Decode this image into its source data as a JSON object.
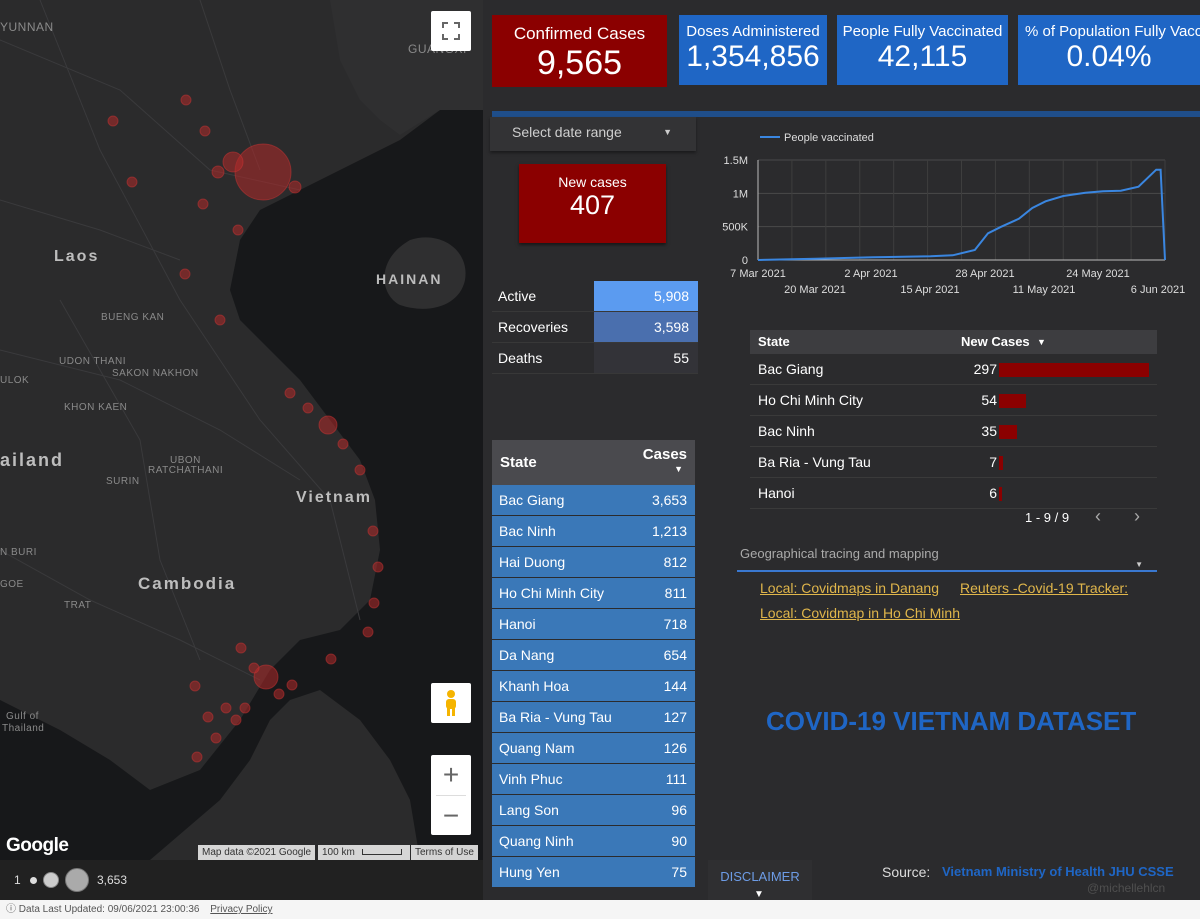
{
  "map": {
    "labels": {
      "laos": "Laos",
      "hainan": "HAINAN",
      "vietnam": "Vietnam",
      "cambodia": "Cambodia",
      "thailand": "ailand",
      "yunnan": "YUNNAN",
      "guangxi": "GUANGXI",
      "bueng_kan": "BUENG KAN",
      "udon_thani": "UDON THANI",
      "sakon_nakhon": "SAKON NAKHON",
      "lok": "ULOK",
      "khon_kaen": "KHON KAEN",
      "ubon": "UBON",
      "ratchathani": "RATCHATHANI",
      "surin": "SURIN",
      "buri": "N BURI",
      "goe": "GOE",
      "trat": "TRAT",
      "gulf1": "Gulf of",
      "gulf2": "Thailand"
    },
    "attribution": {
      "data": "Map data ©2021 Google",
      "scale": "100 km",
      "terms": "Terms of Use"
    },
    "google_logo": "Google",
    "legend": {
      "min": "1",
      "max": "3,653"
    }
  },
  "kpis": {
    "confirmed": {
      "label": "Confirmed Cases",
      "value": "9,565",
      "color": "#8b0000"
    },
    "doses": {
      "label": "Doses Administered",
      "value": "1,354,856",
      "color": "#1f66c5"
    },
    "fully": {
      "label": "People Fully Vaccinated",
      "value": "42,115",
      "color": "#1f66c5"
    },
    "percent": {
      "label": "% of Population Fully Vacc",
      "value": "0.04%",
      "color": "#1f66c5"
    },
    "new_cases": {
      "label": "New cases",
      "value": "407",
      "color": "#8b0000"
    }
  },
  "date_range": {
    "label": "Select date range"
  },
  "status": [
    {
      "name": "Active",
      "value": "5,908",
      "fraction": 1.0,
      "color": "#5b9bf0"
    },
    {
      "name": "Recoveries",
      "value": "3,598",
      "fraction": 1.0,
      "color": "#4a6fae"
    },
    {
      "name": "Deaths",
      "value": "55",
      "fraction": 1.0,
      "color": "#333338"
    }
  ],
  "state_table": {
    "headers": {
      "state": "State",
      "cases": "Cases"
    },
    "rows": [
      {
        "state": "Bac Giang",
        "cases": "3,653"
      },
      {
        "state": "Bac Ninh",
        "cases": "1,213"
      },
      {
        "state": "Hai Duong",
        "cases": "812"
      },
      {
        "state": "Ho Chi Minh City",
        "cases": "811"
      },
      {
        "state": "Hanoi",
        "cases": "718"
      },
      {
        "state": "Da Nang",
        "cases": "654"
      },
      {
        "state": "Khanh Hoa",
        "cases": "144"
      },
      {
        "state": "Ba Ria - Vung Tau",
        "cases": "127"
      },
      {
        "state": "Quang Nam",
        "cases": "126"
      },
      {
        "state": "Vinh Phuc",
        "cases": "111"
      },
      {
        "state": "Lang Son",
        "cases": "96"
      },
      {
        "state": "Quang Ninh",
        "cases": "90"
      },
      {
        "state": "Hung Yen",
        "cases": "75"
      }
    ]
  },
  "chart_data": {
    "type": "line",
    "series": [
      {
        "name": "People vaccinated",
        "x": [
          "7 Mar 2021",
          "20 Mar 2021",
          "2 Apr 2021",
          "15 Apr 2021",
          "20 Apr 2021",
          "25 Apr 2021",
          "28 Apr 2021",
          "1 May 2021",
          "5 May 2021",
          "8 May 2021",
          "11 May 2021",
          "15 May 2021",
          "20 May 2021",
          "24 May 2021",
          "28 May 2021",
          "1 Jun 2021",
          "5 Jun 2021",
          "6 Jun 2021",
          "7 Jun 2021"
        ],
        "values": [
          0,
          20000,
          40000,
          55000,
          70000,
          150000,
          400000,
          500000,
          620000,
          780000,
          880000,
          960000,
          1010000,
          1030000,
          1040000,
          1100000,
          1354856,
          1354856,
          0
        ]
      }
    ],
    "x_ticks_top": [
      "7 Mar 2021",
      "2 Apr 2021",
      "28 Apr 2021",
      "24 May 2021"
    ],
    "x_ticks_bottom": [
      "20 Mar 2021",
      "15 Apr 2021",
      "11 May 2021",
      "6 Jun 2021"
    ],
    "y_ticks": [
      "0",
      "500K",
      "1M",
      "1.5M"
    ],
    "ylim": [
      0,
      1500000
    ],
    "line_color": "#3a86e0",
    "legend": "top-left"
  },
  "new_cases_table": {
    "headers": {
      "state": "State",
      "new_cases": "New Cases"
    },
    "rows": [
      {
        "state": "Bac Giang",
        "value": "297",
        "num": 297
      },
      {
        "state": "Ho Chi Minh City",
        "value": "54",
        "num": 54
      },
      {
        "state": "Bac Ninh",
        "value": "35",
        "num": 35
      },
      {
        "state": "Ba Ria - Vung Tau",
        "value": "7",
        "num": 7
      },
      {
        "state": "Hanoi",
        "value": "6",
        "num": 6
      }
    ],
    "max": 297,
    "pager": "1 - 9 / 9"
  },
  "geo": {
    "label": "Geographical tracing and mapping",
    "links": {
      "danang": "Local: Covidmaps in Danang",
      "reuters": "Reuters -Covid-19 Tracker:",
      "hcm": "Local: Covidmap in Ho Chi Minh"
    }
  },
  "title": "COVID-19 VIETNAM DATASET",
  "disclaimer": "DISCLAIMER",
  "source": {
    "label": "Source:",
    "links": "Vietnam Ministry of Health JHU CSSE"
  },
  "handle": "@michellehlcn",
  "footer": {
    "updated": "Data Last Updated: 09/06/2021 23:00:36",
    "privacy": "Privacy Policy"
  }
}
